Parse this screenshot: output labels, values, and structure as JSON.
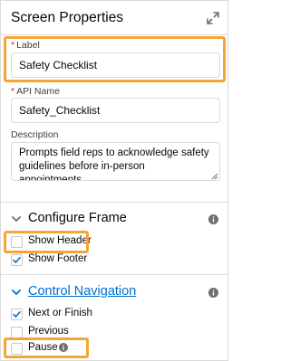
{
  "panel": {
    "title": "Screen Properties"
  },
  "label_field": {
    "label": "Label",
    "required_marker": "*",
    "value": "Safety Checklist"
  },
  "api_field": {
    "label": "API Name",
    "required_marker": "*",
    "value": "Safety_Checklist"
  },
  "description_field": {
    "label": "Description",
    "value": "Prompts field reps to acknowledge safety guidelines before in-person appointments."
  },
  "configure_frame": {
    "title": "Configure Frame",
    "options": [
      {
        "label": "Show Header",
        "checked": false
      },
      {
        "label": "Show Footer",
        "checked": true
      }
    ]
  },
  "control_navigation": {
    "title": "Control Navigation",
    "options": [
      {
        "label": "Next or Finish",
        "checked": true
      },
      {
        "label": "Previous",
        "checked": false
      },
      {
        "label": "Pause",
        "checked": false
      }
    ]
  },
  "colors": {
    "highlight": "#f3a536",
    "link": "#0070d2",
    "required": "#c23934",
    "border": "#dddbda",
    "icon_gray": "#706e6b"
  },
  "icons": {
    "expand": "expand-icon",
    "chevron": "chevron-down-icon",
    "info": "info-icon",
    "check": "check-icon"
  }
}
